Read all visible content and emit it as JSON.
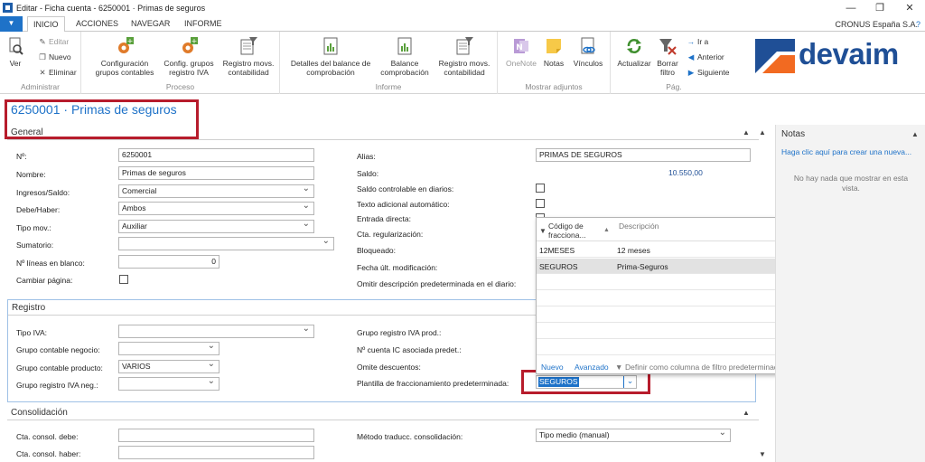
{
  "window": {
    "title": "Editar - Ficha cuenta - 6250001 · Primas de seguros",
    "minimize": "—",
    "restore": "❐",
    "close": "✕"
  },
  "tabs": {
    "items": [
      "INICIO",
      "ACCIONES",
      "NAVEGAR",
      "INFORME"
    ],
    "company": "CRONUS España S.A."
  },
  "ribbon": {
    "administrar": {
      "label": "Administrar",
      "ver": "Ver",
      "editar": "Editar",
      "nuevo": "Nuevo",
      "eliminar": "Eliminar"
    },
    "proceso": {
      "label": "Proceso",
      "config_grupos_contables_1": "Configuración",
      "config_grupos_contables_2": "grupos contables",
      "config_grupos_iva_1": "Config. grupos",
      "config_grupos_iva_2": "registro IVA",
      "registro_movs_1": "Registro movs.",
      "registro_movs_2": "contabilidad"
    },
    "informe": {
      "label": "Informe",
      "detalles_1": "Detalles del balance de",
      "detalles_2": "comprobación",
      "balance_1": "Balance",
      "balance_2": "comprobación",
      "registro_movs_1": "Registro movs.",
      "registro_movs_2": "contabilidad"
    },
    "adjuntos": {
      "label": "Mostrar adjuntos",
      "onenote": "OneNote",
      "notas": "Notas",
      "vinculos": "Vínculos"
    },
    "pag": {
      "label": "Pág.",
      "actualizar": "Actualizar",
      "borrar_filtro_1": "Borrar",
      "borrar_filtro_2": "filtro",
      "ir_a": "Ir a",
      "anterior": "Anterior",
      "siguiente": "Siguiente"
    },
    "logo": "devaim"
  },
  "header": {
    "title": "6250001 · Primas de seguros"
  },
  "general": {
    "title": "General",
    "no_label": "Nº:",
    "no_value": "6250001",
    "nombre_label": "Nombre:",
    "nombre_value": "Primas de seguros",
    "ingresos_label": "Ingresos/Saldo:",
    "ingresos_value": "Comercial",
    "debe_label": "Debe/Haber:",
    "debe_value": "Ambos",
    "tipo_label": "Tipo mov.:",
    "tipo_value": "Auxiliar",
    "sumatorio_label": "Sumatorio:",
    "sumatorio_value": "",
    "lineas_label": "Nº líneas en blanco:",
    "lineas_value": "0",
    "cambiar_label": "Cambiar página:",
    "alias_label": "Alias:",
    "alias_value": "PRIMAS DE SEGUROS",
    "saldo_label": "Saldo:",
    "saldo_value": "10.550,00",
    "controlable_label": "Saldo controlable en diarios:",
    "texto_label": "Texto adicional automático:",
    "entrada_label": "Entrada directa:",
    "cta_label": "Cta. regularización:",
    "bloqueado_label": "Bloqueado:",
    "fecha_label": "Fecha últ. modificación:",
    "omitir_label": "Omitir descripción predeterminada en el diario:"
  },
  "registro": {
    "title": "Registro",
    "tipo_iva_label": "Tipo IVA:",
    "tipo_iva_value": "",
    "grupo_negocio_label": "Grupo contable negocio:",
    "grupo_negocio_value": "",
    "grupo_producto_label": "Grupo contable producto:",
    "grupo_producto_value": "VARIOS",
    "grupo_iva_neg_label": "Grupo registro IVA neg.:",
    "grupo_iva_neg_value": "",
    "grupo_iva_prod_label": "Grupo registro IVA prod.:",
    "cuenta_ic_label": "Nº cuenta IC asociada predet.:",
    "omite_label": "Omite descuentos:",
    "plantilla_label": "Plantilla de fraccionamiento predeterminada:",
    "plantilla_value": "SEGUROS"
  },
  "consolidacion": {
    "title": "Consolidación",
    "debe_label": "Cta. consol. debe:",
    "haber_label": "Cta. consol. haber:",
    "metodo_label": "Método traducc. consolidación:",
    "metodo_value": "Tipo medio (manual)"
  },
  "lookup": {
    "col_code": "Código de fracciona...",
    "col_desc": "Descripción",
    "rows": [
      {
        "code": "12MESES",
        "desc": "12 meses"
      },
      {
        "code": "SEGUROS",
        "desc": "Prima-Seguros"
      }
    ],
    "nuevo": "Nuevo",
    "avanzado": "Avanzado",
    "definir": "Definir como columna de filtro predeterminado"
  },
  "notes": {
    "title": "Notas",
    "create_link": "Haga clic aquí para crear una nueva...",
    "empty": "No hay nada que mostrar en esta vista."
  },
  "colors": {
    "accent_blue": "#1e72c8",
    "highlight_red": "#b71c2c",
    "logo_blue": "#1f4f96",
    "logo_orange": "#f26a21"
  }
}
